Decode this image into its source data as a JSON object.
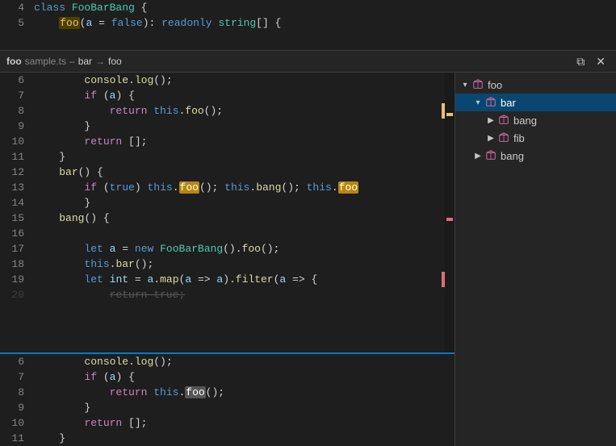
{
  "colors": {
    "background": "#1e1e1e",
    "sidebar_bg": "#252526",
    "active_line": "#2a2d2e",
    "active_tree": "#094771",
    "accent": "#007acc",
    "yellow": "#e5c07b",
    "red": "#e06c75"
  },
  "breadcrumb": {
    "prefix": "foo",
    "filename": "sample.ts",
    "separator1": "–",
    "part1": "bar",
    "arrow": "→",
    "part2": "foo",
    "action1_label": "⟳",
    "action2_label": "✕"
  },
  "top_lines": [
    {
      "num": "4",
      "content": "class FooBarBang {"
    },
    {
      "num": "5",
      "content": "    foo(a = false): readonly string[] {"
    }
  ],
  "middle_lines": [
    {
      "num": "6",
      "content": "        console.log();",
      "marker": null
    },
    {
      "num": "7",
      "content": "        if (a) {",
      "marker": null
    },
    {
      "num": "8",
      "content": "            return this.foo();",
      "marker": "yellow"
    },
    {
      "num": "9",
      "content": "        }",
      "marker": null
    },
    {
      "num": "10",
      "content": "        return [];",
      "marker": null
    },
    {
      "num": "11",
      "content": "    }",
      "marker": null
    },
    {
      "num": "12",
      "content": "    bar() {",
      "marker": null
    },
    {
      "num": "13",
      "content": "        if (true) this.foo(); this.bang(); this.foo",
      "marker": null
    },
    {
      "num": "14",
      "content": "        }",
      "marker": null
    },
    {
      "num": "15",
      "content": "    bang() {",
      "marker": null
    },
    {
      "num": "16",
      "content": "",
      "marker": null
    },
    {
      "num": "17",
      "content": "        let a = new FooBarBang().foo();",
      "marker": null
    },
    {
      "num": "18",
      "content": "        this.bar();",
      "marker": null
    },
    {
      "num": "19",
      "content": "        let int = a.map(a => a).filter(a => {",
      "marker": "red"
    }
  ],
  "bottom_lines": [
    {
      "num": "6",
      "content": "        console.log();",
      "marker": null
    },
    {
      "num": "7",
      "content": "        if (a) {",
      "marker": null
    },
    {
      "num": "8",
      "content": "            return this.foo();",
      "marker": null
    },
    {
      "num": "9",
      "content": "        }",
      "marker": null
    },
    {
      "num": "10",
      "content": "        return [];",
      "marker": null
    },
    {
      "num": "11",
      "content": "    }",
      "marker": null
    }
  ],
  "outline": {
    "items": [
      {
        "id": "foo",
        "label": "foo",
        "indent": "indent-1",
        "expanded": true,
        "active": false,
        "has_arrow": true,
        "arrow_down": true
      },
      {
        "id": "bar",
        "label": "bar",
        "indent": "indent-2",
        "expanded": true,
        "active": true,
        "has_arrow": true,
        "arrow_down": true
      },
      {
        "id": "bang-child",
        "label": "bang",
        "indent": "indent-3",
        "expanded": false,
        "active": false,
        "has_arrow": true,
        "arrow_down": false
      },
      {
        "id": "fib",
        "label": "fib",
        "indent": "indent-3",
        "expanded": false,
        "active": false,
        "has_arrow": true,
        "arrow_down": false
      },
      {
        "id": "bang-sibling",
        "label": "bang",
        "indent": "indent-2",
        "expanded": false,
        "active": false,
        "has_arrow": true,
        "arrow_down": false
      }
    ]
  }
}
